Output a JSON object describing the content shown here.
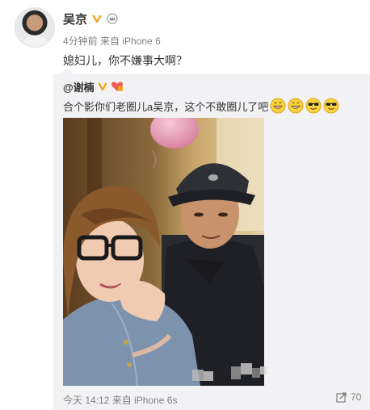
{
  "post": {
    "author": "吴京",
    "time": "4分钟前",
    "source_prefix": "来自",
    "source": "iPhone 6",
    "text": "媳妇儿，你不嫌事大啊？"
  },
  "repost": {
    "author": "@谢楠",
    "text": "合个影你们老圈儿a吴京，这个不敢圈儿了吧",
    "emoji": [
      "grin-emoji",
      "grin-emoji",
      "sunglasses-emoji",
      "sunglasses-emoji"
    ],
    "time": "今天 14:12",
    "source_prefix": "来自",
    "source": "iPhone 6s",
    "share_count": "70"
  },
  "colors": {
    "verified": "#f5a623",
    "meta_text": "#808080",
    "repost_bg": "#f2f2f5"
  }
}
